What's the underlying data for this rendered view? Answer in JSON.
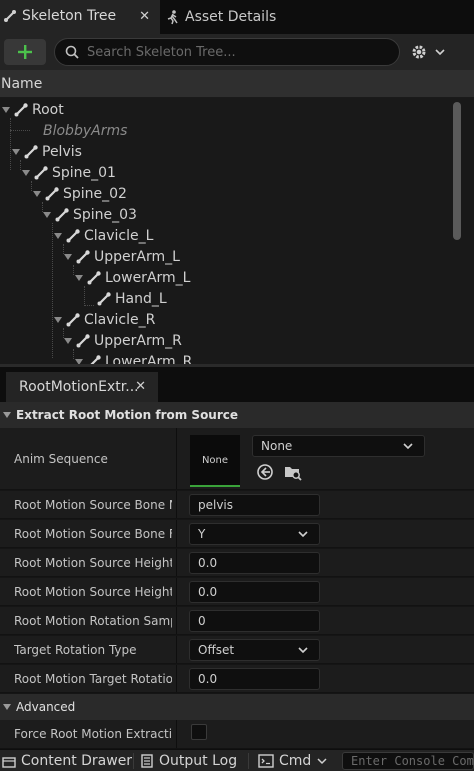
{
  "top_tabs": {
    "skeleton_tree": "Skeleton Tree",
    "asset_details": "Asset Details"
  },
  "toolbar": {
    "add_icon": "plus-icon",
    "search_placeholder": "Search Skeleton Tree...",
    "settings_icon": "gear-icon"
  },
  "tree": {
    "column_header": "Name",
    "items": [
      {
        "label": "Root"
      },
      {
        "label": "BlobbyArms"
      },
      {
        "label": "Pelvis"
      },
      {
        "label": "Spine_01"
      },
      {
        "label": "Spine_02"
      },
      {
        "label": "Spine_03"
      },
      {
        "label": "Clavicle_L"
      },
      {
        "label": "UpperArm_L"
      },
      {
        "label": "LowerArm_L"
      },
      {
        "label": "Hand_L"
      },
      {
        "label": "Clavicle_R"
      },
      {
        "label": "UpperArm_R"
      },
      {
        "label": "LowerArm_R"
      }
    ]
  },
  "details": {
    "tab_label": "RootMotionExtr...",
    "section_extract": "Extract Root Motion from Source",
    "anim_sequence": {
      "label": "Anim Sequence",
      "thumbnail_text": "None",
      "combo_value": "None"
    },
    "props": [
      {
        "label": "Root Motion Source Bone Na...",
        "value": "pelvis"
      },
      {
        "label": "Root Motion Source Bone Fo...",
        "value": "Y"
      },
      {
        "label": "Root Motion Source Height a...",
        "value": "0.0"
      },
      {
        "label": "Root Motion Source Height a...",
        "value": "0.0"
      },
      {
        "label": "Root Motion Rotation Sampli...",
        "value": "0"
      },
      {
        "label": "Target Rotation Type",
        "value": "Offset"
      },
      {
        "label": "Root Motion Target Rotation...",
        "value": "0.0"
      }
    ],
    "section_advanced": "Advanced",
    "force_label": "Force Root Motion Extraction"
  },
  "bottom_bar": {
    "content_drawer": "Content Drawer",
    "output_log": "Output Log",
    "cmd": "Cmd",
    "console_placeholder": "Enter Console Command"
  },
  "colors": {
    "accent_green": "#3aa33a",
    "panel_bg": "#1c1c1c",
    "header_bg": "#2a2a2a"
  }
}
